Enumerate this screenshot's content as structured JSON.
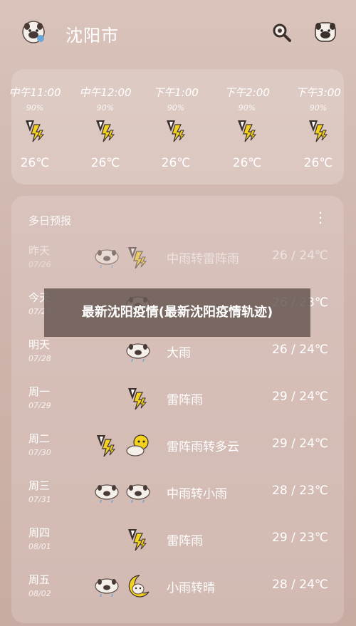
{
  "header": {
    "city": "沈阳市",
    "logo_icon": "pug-logo-icon",
    "search_icon": "magnifier-icon",
    "avatar_icon": "pug-avatar-icon"
  },
  "hourly": [
    {
      "time": "中午11:00",
      "precip": "90%",
      "temp": "26℃",
      "icon": "thunderstorm-icon"
    },
    {
      "time": "中午12:00",
      "precip": "90%",
      "temp": "26℃",
      "icon": "thunderstorm-icon"
    },
    {
      "time": "下午1:00",
      "precip": "90%",
      "temp": "26℃",
      "icon": "thunderstorm-icon"
    },
    {
      "time": "下午2:00",
      "precip": "90%",
      "temp": "26℃",
      "icon": "thunderstorm-icon"
    },
    {
      "time": "下午3:00",
      "precip": "90%",
      "temp": "26℃",
      "icon": "thunderstorm-icon"
    }
  ],
  "forecast": {
    "title": "多日预报",
    "more_label": "⋮",
    "days": [
      {
        "day": "昨天",
        "date": "07/26",
        "desc": "中雨转雷阵雨",
        "temp": "26 / 24℃",
        "icon1": "rain-cloud-icon",
        "icon2": "thunderstorm-icon"
      },
      {
        "day": "今天",
        "date": "07/27",
        "desc": "",
        "temp": "26 / 23℃",
        "icon1": "",
        "icon2": "rain-cloud-icon"
      },
      {
        "day": "明天",
        "date": "07/28",
        "desc": "大雨",
        "temp": "26 / 24℃",
        "icon1": "",
        "icon2": "rain-cloud-icon"
      },
      {
        "day": "周一",
        "date": "07/29",
        "desc": "雷阵雨",
        "temp": "29 / 24℃",
        "icon1": "",
        "icon2": "thunderstorm-icon"
      },
      {
        "day": "周二",
        "date": "07/30",
        "desc": "雷阵雨转多云",
        "temp": "29 / 24℃",
        "icon1": "thunderstorm-icon",
        "icon2": "partly-cloudy-icon"
      },
      {
        "day": "周三",
        "date": "07/31",
        "desc": "中雨转小雨",
        "temp": "28 / 23℃",
        "icon1": "rain-cloud-icon",
        "icon2": "rain-cloud-icon"
      },
      {
        "day": "周四",
        "date": "08/01",
        "desc": "雷阵雨",
        "temp": "29 / 23℃",
        "icon1": "",
        "icon2": "thunderstorm-icon"
      },
      {
        "day": "周五",
        "date": "08/02",
        "desc": "小雨转晴",
        "temp": "28 / 24℃",
        "icon1": "rain-cloud-icon",
        "icon2": "moon-icon"
      }
    ]
  },
  "banner": {
    "text": "最新沈阳疫情(最新沈阳疫情轨迹)"
  },
  "colors": {
    "background": "#d2b8b0",
    "card": "#e6d4cf",
    "banner": "#695854",
    "lightning": "#f2d21f"
  }
}
